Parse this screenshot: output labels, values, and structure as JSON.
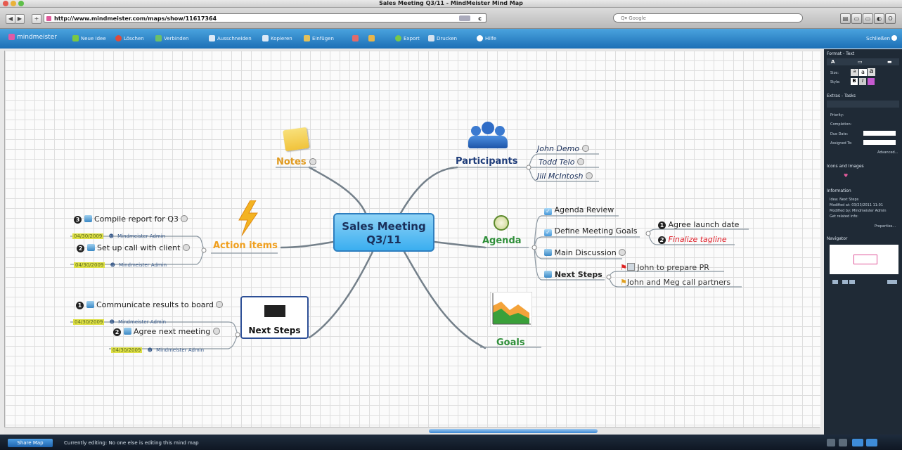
{
  "window": {
    "title": "Sales Meeting Q3/11 - MindMeister Mind Map"
  },
  "browser": {
    "url": "http://www.mindmeister.com/maps/show/11617364",
    "search_placeholder": "Google"
  },
  "toolbar": {
    "logo": "mindmeister",
    "items": [
      "Neue Idee",
      "Löschen",
      "Verbinden",
      "Ausschneiden",
      "Kopieren",
      "Einfügen",
      "Export",
      "Drucken",
      "Hilfe"
    ],
    "close_label": "Schließen"
  },
  "map": {
    "central": [
      "Sales Meeting",
      "Q3/11"
    ],
    "notes": "Notes",
    "participants": {
      "label": "Participants",
      "people": [
        "John Demo",
        "Todd Telo",
        "Jill McIntosh"
      ]
    },
    "action_items": {
      "label": "Action items",
      "tasks": [
        {
          "num": "3",
          "text": "Compile report for Q3",
          "date": "04/30/2009",
          "owner": "Mindmeister Admin"
        },
        {
          "num": "2",
          "text": "Set up call with client",
          "date": "04/30/2009",
          "owner": "Mindmeister Admin"
        }
      ]
    },
    "agenda": {
      "label": "Agenda",
      "items": [
        "Agenda Review",
        "Define Meeting Goals",
        "Main Discussion",
        "Next Steps"
      ],
      "goals_children": [
        {
          "num": "1",
          "text": "Agree launch date"
        },
        {
          "num": "2",
          "text": "Finalize tagline"
        }
      ],
      "next_children": [
        "John to prepare PR",
        "John and Meg call partners"
      ]
    },
    "goals": "Goals",
    "next_steps": {
      "label": "Next Steps",
      "tasks": [
        {
          "num": "1",
          "text": "Communicate results to board",
          "date": "04/30/2009",
          "owner": "Mindmeister Admin"
        },
        {
          "num": "2",
          "text": "Agree next meeting",
          "date": "04/30/2009",
          "owner": "Mindmeister Admin"
        }
      ]
    }
  },
  "panel": {
    "format_title": "Format - Text",
    "size_label": "Size:",
    "style_label": "Style:",
    "extras_title": "Extras - Tasks",
    "priority_label": "Priority:",
    "completion_label": "Completion:",
    "due_label": "Due Date:",
    "assigned_label": "Assigned To:",
    "advanced_label": "Advanced...",
    "icons_title": "Icons and Images",
    "info_title": "Information",
    "info_idea": "Idea: Next Steps",
    "info_modified_at": "Modified at: 03/23/2011 11:01",
    "info_modified_by": "Modified by: Mindmeister Admin",
    "info_related": "Get related info:",
    "properties_label": "Properties...",
    "navigator_title": "Navigator"
  },
  "status": {
    "share_label": "Share Map",
    "editing_text": "Currently editing:  No one else is editing this mind map"
  },
  "colors": {
    "blue_header": "#2a86cf",
    "central_fill": "#5bbdf1",
    "orange": "#f0a020",
    "green": "#2f8f3a",
    "navy": "#1f3d7a",
    "tagline_red": "#e0202a"
  }
}
